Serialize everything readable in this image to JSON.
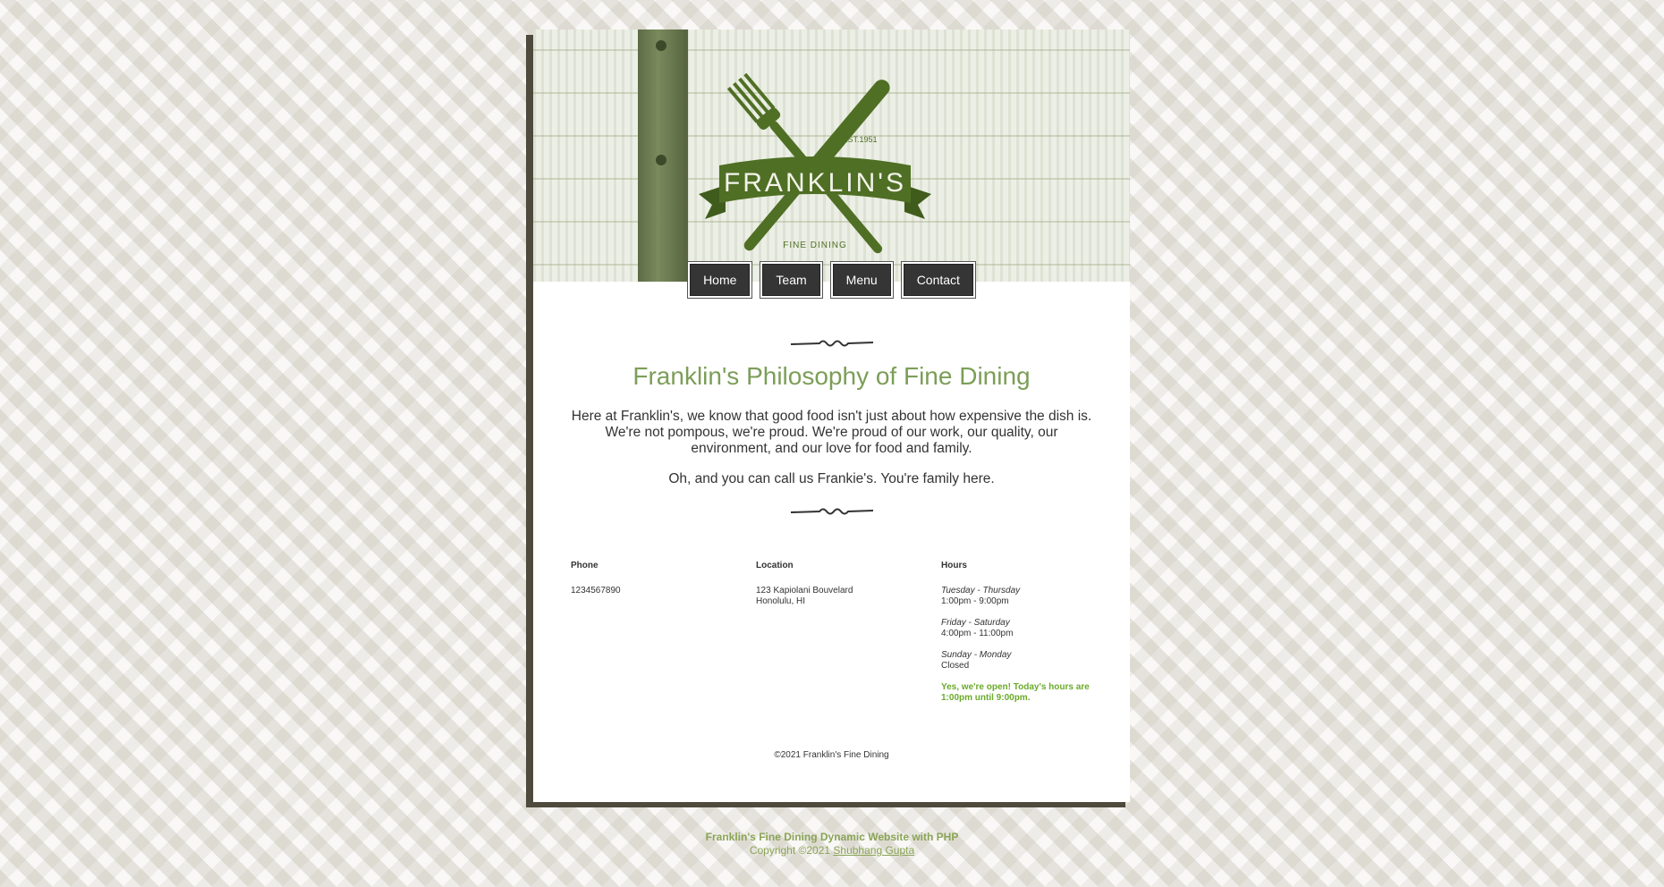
{
  "nav": {
    "items": [
      {
        "label": "Home"
      },
      {
        "label": "Team"
      },
      {
        "label": "Menu"
      },
      {
        "label": "Contact"
      }
    ]
  },
  "logo": {
    "name": "FRANKLIN'S",
    "established": "EST.1951",
    "tagline": "FINE DINING"
  },
  "main": {
    "title": "Franklin's Philosophy of Fine Dining",
    "intro": "Here at Franklin's, we know that good food isn't just about how expensive the dish is. We're not pompous, we're proud. We're proud of our work, our quality, our environment, and our love for food and family.",
    "family_note": "Oh, and you can call us Frankie's. You're family here."
  },
  "info": {
    "phone": {
      "heading": "Phone",
      "value": "1234567890"
    },
    "location": {
      "heading": "Location",
      "line1": "123 Kapiolani Bouvelard",
      "line2": "Honolulu, HI"
    },
    "hours": {
      "heading": "Hours",
      "blocks": [
        {
          "days": "Tuesday - Thursday",
          "time": "1:00pm - 9:00pm"
        },
        {
          "days": "Friday - Saturday",
          "time": "4:00pm - 11:00pm"
        },
        {
          "days": "Sunday - Monday",
          "time": "Closed"
        }
      ],
      "open_note": "Yes, we're open! Today's hours are 1:00pm until 9:00pm."
    }
  },
  "page_footer": {
    "copyright": "©2021 Franklin's Fine Dining"
  },
  "site_footer": {
    "title": "Franklin's Fine Dining Dynamic Website with PHP",
    "copyright_prefix": "Copyright ©2021",
    "author_link": "Shubhang Gupta"
  },
  "colors": {
    "accent": "#7c9e58",
    "logo_green": "#4f6f24",
    "open_green": "#6aaa2a",
    "nav_bg": "#353535"
  }
}
